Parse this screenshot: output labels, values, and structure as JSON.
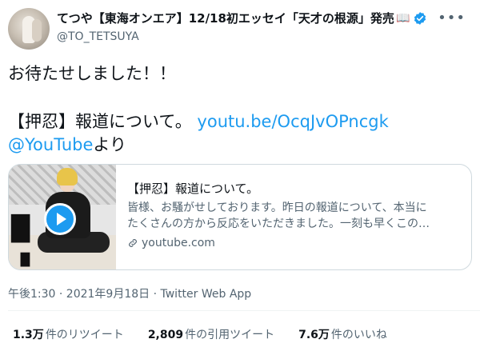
{
  "author": {
    "display_name": "てつや【東海オンエア】12/18初エッセイ「天才の根源」発売",
    "handle": "@TO_TETSUYA"
  },
  "tweet": {
    "line1": "お待たせしました！！",
    "line2_text": "【押忍】報道について。 ",
    "line2_link": "youtu.be/OcqJvOPncgk",
    "line3_link": "@YouTube",
    "line3_text": "より"
  },
  "card": {
    "title": "【押忍】報道について。",
    "desc_line1": "皆様、お騒がせしております。昨日の報道について、本当に",
    "desc_line2": "たくさんの方から反応をいただきました。一刻も早くこの…",
    "domain": "youtube.com"
  },
  "meta": {
    "text": "午後1:30 · 2021年9月18日 · Twitter Web App"
  },
  "stats": [
    {
      "num": "1.3万",
      "label": "件のリツイート"
    },
    {
      "num": "2,809",
      "label": "件の引用ツイート"
    },
    {
      "num": "7.6万",
      "label": "件のいいね"
    }
  ],
  "colors": {
    "link": "#1d9bf0",
    "secondary_text": "#536471",
    "primary_text": "#0f1419"
  },
  "icons": [
    "book-icon",
    "verified-icon",
    "more-icon",
    "play-icon",
    "link-icon"
  ]
}
